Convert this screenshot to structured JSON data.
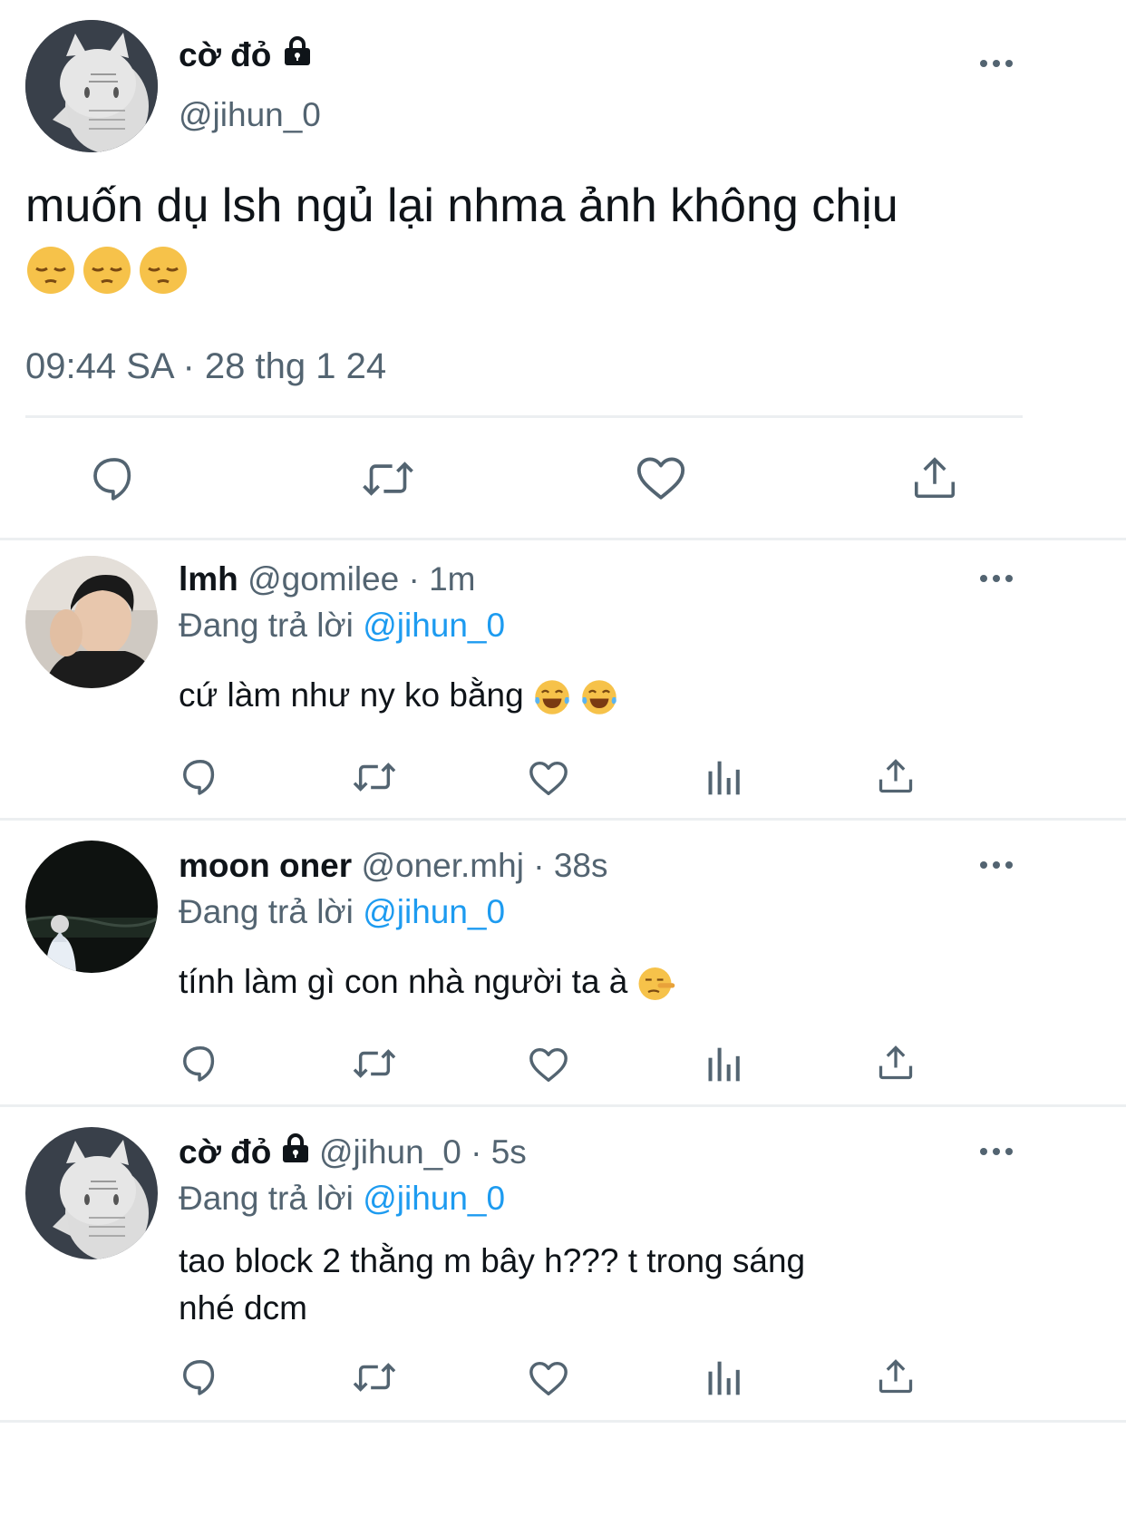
{
  "main_tweet": {
    "display_name": "cờ đỏ",
    "handle": "@jihun_0",
    "text": "muốn dụ lsh ngủ lại nhma ảnh không chịu",
    "timestamp": "09:44 SA · 28 thg 1 24"
  },
  "replies": [
    {
      "display_name": "lmh",
      "handle": "@gomilee",
      "time": "· 1m",
      "replying_label": "Đang trả lời",
      "replying_to": "@jihun_0",
      "text": "cứ làm như ny ko bằng"
    },
    {
      "display_name": "moon oner",
      "handle": "@oner.mhj",
      "time": "· 38s",
      "replying_label": "Đang trả lời",
      "replying_to": "@jihun_0",
      "text": "tính làm gì con nhà người ta à"
    },
    {
      "display_name": "cờ đỏ",
      "handle": "@jihun_0",
      "time": "· 5s",
      "replying_label": "Đang trả lời",
      "replying_to": "@jihun_0",
      "text_line1": "tao block 2 thằng m bây h??? t trong sáng",
      "text_line2": "nhé dcm"
    }
  ],
  "icons": {
    "reply": "speech-bubble-icon",
    "retweet": "retweet-icon",
    "like": "heart-icon",
    "views": "bar-chart-icon",
    "share": "share-icon",
    "more": "more-horizontal-icon",
    "lock": "lock-icon"
  },
  "colors": {
    "text": "#0f1419",
    "muted": "#536471",
    "link": "#1d9bf0",
    "divider": "#eceff1"
  }
}
